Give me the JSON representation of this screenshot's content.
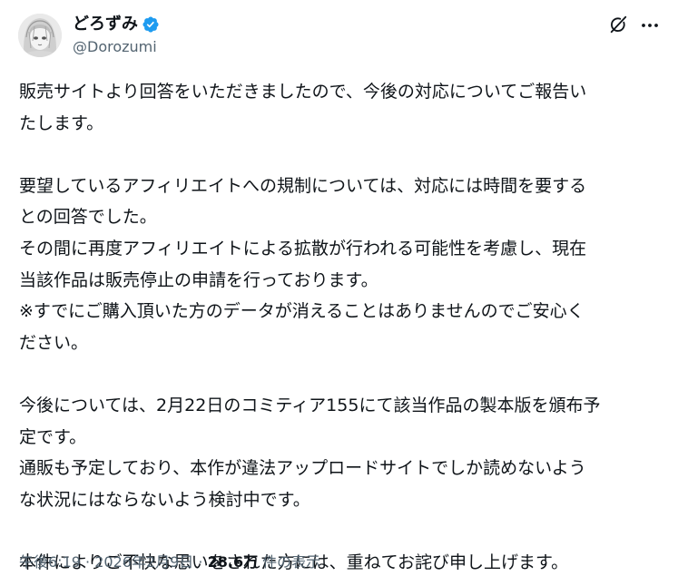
{
  "author": {
    "display_name": "どろずみ",
    "handle": "@Dorozumi",
    "verified": true,
    "verified_color": "#1d9bf0"
  },
  "post": {
    "lines": [
      "販売サイトより回答をいただきましたので、今後の対応についてご報告い",
      "たします。",
      "",
      "要望しているアフィリエイトへの規制については、対応には時間を要する",
      "との回答でした。",
      "その間に再度アフィリエイトによる拡散が行われる可能性を考慮し、現在",
      "当該作品は販売停止の申請を行っております。",
      "※すでにご購入頂いた方のデータが消えることはありませんのでご安心く",
      "ださい。",
      "",
      "今後については、2月22日のコミティア155にて該当作品の製本版を頒布予",
      "定です。",
      "通販も予定しており、本作が違法アップロードサイトでしか読めないよう",
      "な状況にはならないよう検討中です。",
      "",
      "本件によりご不快な思いをされた方には、重ねてお詫び申し上げます。"
    ]
  },
  "meta": {
    "time": "午後6:19",
    "separator": "·",
    "date": "2026年2月9日",
    "views_count": "28.6万",
    "views_label": "件の表示"
  },
  "icons": {
    "grok": "grok-icon",
    "more": "more-icon",
    "verified": "verified-badge-icon"
  }
}
